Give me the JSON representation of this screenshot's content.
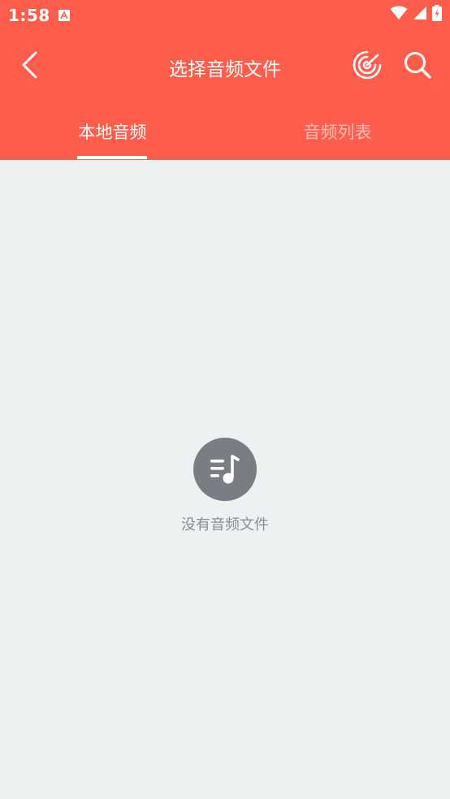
{
  "status_bar": {
    "time": "1:58",
    "notification_icon": "app-notification-icon",
    "icons": [
      "wifi-icon",
      "signal-icon",
      "battery-charging-icon"
    ]
  },
  "toolbar": {
    "title": "选择音频文件",
    "back_icon": "chevron-left-icon",
    "radar_icon": "radar-scan-icon",
    "search_icon": "search-icon"
  },
  "tabs": [
    {
      "label": "本地音频",
      "active": true
    },
    {
      "label": "音频列表",
      "active": false
    }
  ],
  "empty_state": {
    "icon": "music-list-icon",
    "message": "没有音频文件"
  },
  "colors": {
    "header": "#ff5d4b",
    "background": "#eef1f2",
    "empty_icon": "#7b7d84",
    "empty_text": "#8a8c92"
  }
}
